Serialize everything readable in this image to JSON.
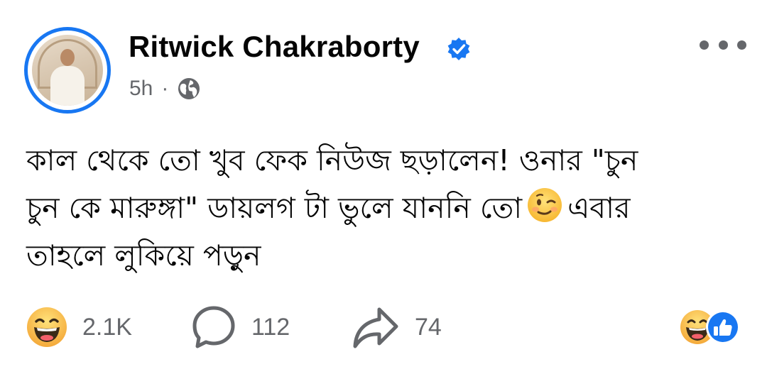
{
  "post": {
    "author": "Ritwick Chakraborty",
    "verified": true,
    "time": "5h",
    "separator": "·",
    "audience_icon": "globe-icon",
    "text_line1": "কাল থেকে তো খুব ফেক নিউজ ছড়ালেন! ওনার  \"চুন",
    "text_line2a": "চুন কে মারুঙ্গা\" ডায়লগ টা ভুলে যাননি তো",
    "text_line2b": "এবার",
    "text_line3": "তাহলে লুকিয়ে পড়ুন",
    "inline_emoji": "winking-face-emoji"
  },
  "footer": {
    "reactions_count": "2.1K",
    "comments_count": "112",
    "shares_count": "74",
    "reaction_icons": [
      "laughing-face-icon",
      "like-thumb-icon"
    ]
  },
  "colors": {
    "accent": "#1877f2",
    "secondary_text": "#65676b",
    "primary_text": "#050505",
    "emoji_yellow": "#ffcb3d"
  }
}
